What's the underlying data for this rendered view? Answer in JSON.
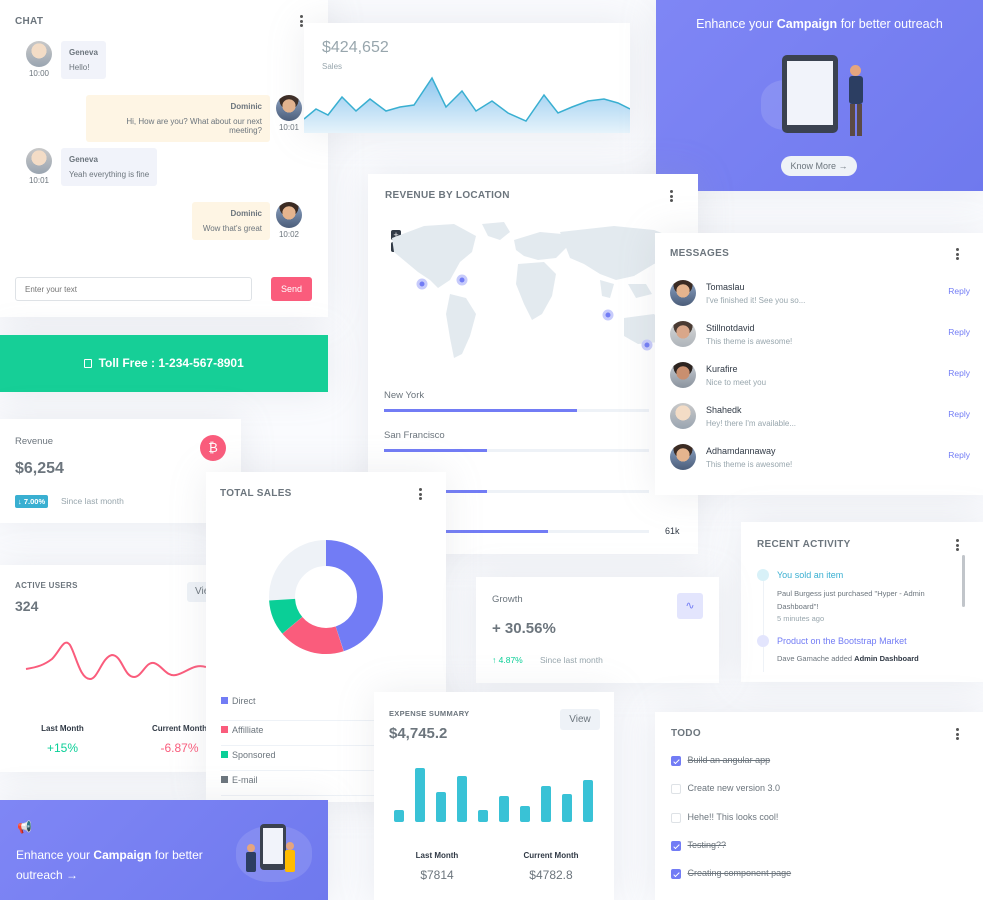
{
  "chat": {
    "title": "CHAT",
    "messages": [
      {
        "name": "Geneva",
        "text": "Hello!",
        "time": "10:00"
      },
      {
        "name": "Dominic",
        "text": "Hi, How are you? What about our next meeting?",
        "time": "10:01"
      },
      {
        "name": "Geneva",
        "text": "Yeah everything is fine",
        "time": "10:01"
      },
      {
        "name": "Dominic",
        "text": "Wow that's great",
        "time": "10:02"
      }
    ],
    "input_placeholder": "Enter your text",
    "send_label": "Send"
  },
  "sales": {
    "value": "$424,652",
    "label": "Sales"
  },
  "campaign_top": {
    "text_prefix": "Enhance your",
    "text_bold": "Campaign",
    "text_suffix": "for better outreach",
    "button": "Know More"
  },
  "location": {
    "title": "REVENUE BY LOCATION",
    "zoom_in": "+",
    "zoom_out": "−",
    "items": [
      {
        "name": "New York",
        "progress": 0.73
      },
      {
        "name": "San Francisco",
        "progress": 0.39
      },
      {
        "name": "",
        "progress": 0.39
      },
      {
        "name": "",
        "progress": 0.62,
        "value": "61k"
      }
    ]
  },
  "messages": {
    "title": "MESSAGES",
    "reply_label": "Reply",
    "items": [
      {
        "name": "Tomaslau",
        "text": "I've finished it! See you so..."
      },
      {
        "name": "Stillnotdavid",
        "text": "This theme is awesome!"
      },
      {
        "name": "Kurafire",
        "text": "Nice to meet you"
      },
      {
        "name": "Shahedk",
        "text": "Hey! there I'm available..."
      },
      {
        "name": "Adhamdannaway",
        "text": "This theme is awesome!"
      }
    ]
  },
  "toll": {
    "text": "Toll Free : 1-234-567-8901"
  },
  "revenue": {
    "label": "Revenue",
    "value": "$6,254",
    "badge": "7.00%",
    "since": "Since last month",
    "icon_symbol": "₿"
  },
  "total_sales": {
    "title": "TOTAL SALES",
    "legend": [
      {
        "name": "Direct",
        "color": "#727cf5"
      },
      {
        "name": "Affilliate",
        "color": "#fa5c7c"
      },
      {
        "name": "Sponsored",
        "color": "#0acf97"
      },
      {
        "name": "E-mail",
        "color": "#6c757d"
      }
    ]
  },
  "active_users": {
    "title": "ACTIVE USERS",
    "value": "324",
    "view": "View",
    "last_label": "Last Month",
    "last_value": "+15%",
    "current_label": "Current Month",
    "current_value": "-6.87%"
  },
  "recent_activity": {
    "title": "RECENT ACTIVITY",
    "items": [
      {
        "title": "You sold an item",
        "desc": "Paul Burgess just purchased \"Hyper - Admin Dashboard\"!",
        "time": "5 minutes ago"
      },
      {
        "title": "Product on the Bootstrap Market",
        "desc_prefix": "Dave Gamache added",
        "desc_bold": "Admin Dashboard"
      }
    ]
  },
  "growth": {
    "label": "Growth",
    "value": "+ 30.56%",
    "pct": "4.87%",
    "since": "Since last month"
  },
  "expense": {
    "title": "EXPENSE SUMMARY",
    "value": "$4,745.2",
    "view": "View",
    "last_label": "Last Month",
    "last_value": "$7814",
    "current_label": "Current Month",
    "current_value": "$4782.8"
  },
  "todo": {
    "title": "TODO",
    "items": [
      {
        "text": "Build an angular app",
        "done": true
      },
      {
        "text": "Create new version 3.0",
        "done": false
      },
      {
        "text": "Hehe!! This looks cool!",
        "done": false
      },
      {
        "text": "Testing??",
        "done": true
      },
      {
        "text": "Creating component page",
        "done": true
      }
    ]
  },
  "campaign_bottom": {
    "text_prefix": "Enhance your",
    "text_bold": "Campaign",
    "text_suffix": "for better outreach"
  }
}
